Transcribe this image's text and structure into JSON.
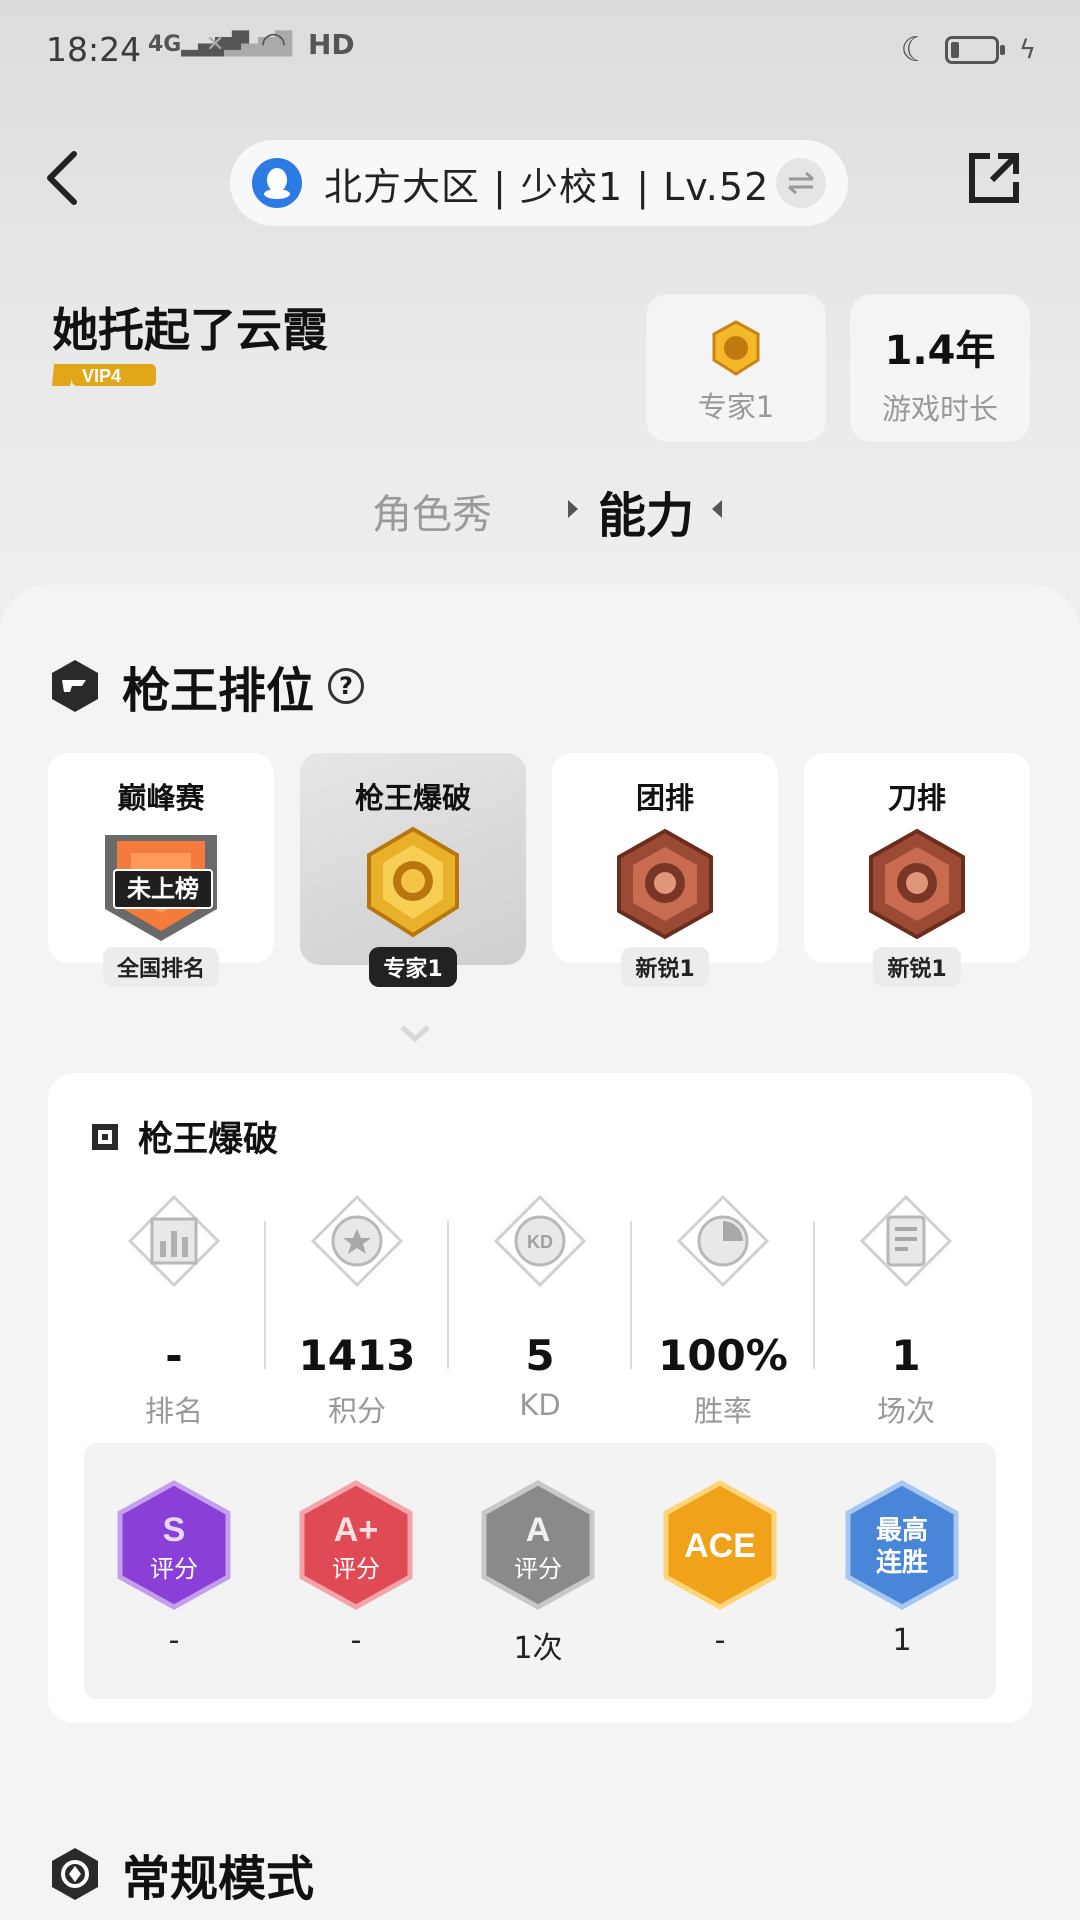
{
  "status_bar": {
    "time": "18:24",
    "net1": "4G",
    "net2": "HD"
  },
  "header": {
    "server_info": "北方大区 | 少校1 | Lv.52"
  },
  "profile": {
    "username": "她托起了云霞",
    "vip": "VIP4",
    "rank_card": {
      "label": "专家1"
    },
    "playtime_card": {
      "value": "1.4年",
      "label": "游戏时长"
    }
  },
  "tabs": {
    "tab1": "角色秀",
    "tab2": "能力",
    "active": "能力"
  },
  "ranked_section": {
    "title": "枪王排位",
    "cards": [
      {
        "name": "巅峰赛",
        "badge_text": "未上榜",
        "tag": "全国排名"
      },
      {
        "name": "枪王爆破",
        "tag": "专家1",
        "selected": true
      },
      {
        "name": "团排",
        "tag": "新锐1"
      },
      {
        "name": "刀排",
        "tag": "新锐1"
      }
    ]
  },
  "detail_panel": {
    "title": "枪王爆破",
    "stats": [
      {
        "icon": "bar-chart-icon",
        "value": "-",
        "label": "排名"
      },
      {
        "icon": "star-medal-icon",
        "value": "1413",
        "label": "积分"
      },
      {
        "icon": "kd-icon",
        "value": "5",
        "label": "KD"
      },
      {
        "icon": "pie-chart-icon",
        "value": "100%",
        "label": "胜率"
      },
      {
        "icon": "document-icon",
        "value": "1",
        "label": "场次"
      }
    ],
    "grades": [
      {
        "top": "S",
        "bottom": "评分",
        "value": "-",
        "color": "#8a3fd6"
      },
      {
        "top": "A+",
        "bottom": "评分",
        "value": "-",
        "color": "#e04a55"
      },
      {
        "top": "A",
        "bottom": "评分",
        "value": "1次",
        "color": "#8a8a8a"
      },
      {
        "top": "ACE",
        "bottom": "",
        "value": "-",
        "color": "#f0a21a"
      },
      {
        "top": "最高",
        "bottom": "连胜",
        "value": "1",
        "color": "#4a86d8"
      }
    ]
  },
  "normal_section": {
    "title": "常规模式"
  }
}
